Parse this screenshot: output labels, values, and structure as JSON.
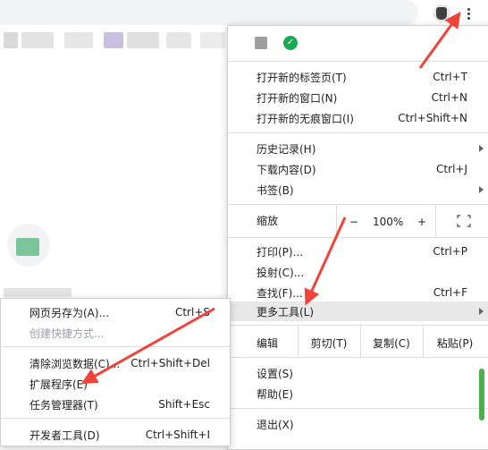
{
  "toolbar": {
    "profile_icon": "profile-avatar-icon",
    "menu_icon": "three-dot-menu-icon"
  },
  "menu": {
    "extensions": [
      "puzzle-extension-icon",
      "green-check-extension-icon"
    ],
    "new_tab": {
      "label": "打开新的标签页(T)",
      "shortcut": "Ctrl+T"
    },
    "new_window": {
      "label": "打开新的窗口(N)",
      "shortcut": "Ctrl+N"
    },
    "new_incognito": {
      "label": "打开新的无痕窗口(I)",
      "shortcut": "Ctrl+Shift+N"
    },
    "history": {
      "label": "历史记录(H)"
    },
    "downloads": {
      "label": "下载内容(D)",
      "shortcut": "Ctrl+J"
    },
    "bookmarks": {
      "label": "书签(B)"
    },
    "zoom": {
      "label": "缩放",
      "minus": "−",
      "value": "100%",
      "plus": "+"
    },
    "print": {
      "label": "打印(P)...",
      "shortcut": "Ctrl+P"
    },
    "cast": {
      "label": "投射(C)..."
    },
    "find": {
      "label": "查找(F)...",
      "shortcut": "Ctrl+F"
    },
    "more_tools": {
      "label": "更多工具(L)"
    },
    "edit": {
      "label": "编辑",
      "cut": "剪切(T)",
      "copy": "复制(C)",
      "paste": "粘贴(P)"
    },
    "settings": {
      "label": "设置(S)"
    },
    "help": {
      "label": "帮助(E)"
    },
    "exit": {
      "label": "退出(X)"
    }
  },
  "submenu": {
    "save_page": {
      "label": "网页另存为(A)...",
      "shortcut": "Ctrl+S"
    },
    "create_shortcut": {
      "label": "创建快捷方式..."
    },
    "clear_data": {
      "label": "清除浏览数据(C)...",
      "shortcut": "Ctrl+Shift+Del"
    },
    "extensions": {
      "label": "扩展程序(E)"
    },
    "task_manager": {
      "label": "任务管理器(T)",
      "shortcut": "Shift+Esc"
    },
    "dev_tools": {
      "label": "开发者工具(D)",
      "shortcut": "Ctrl+Shift+I"
    }
  },
  "colors": {
    "annotation_arrow": "#f0433a",
    "highlight": "#e8e8e8",
    "accent_green": "#1aaa55"
  }
}
